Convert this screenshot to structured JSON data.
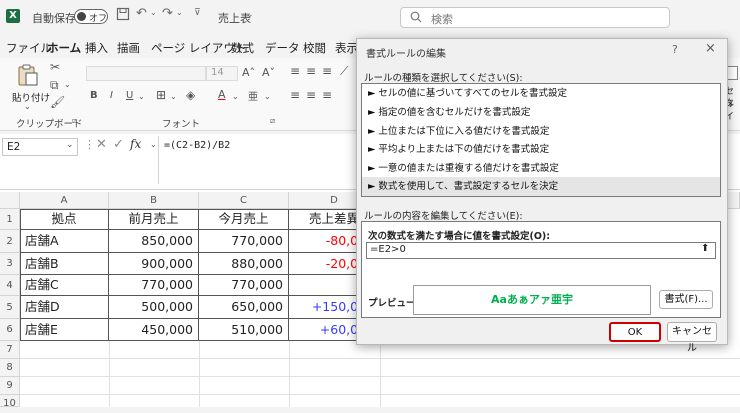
{
  "titlebar": {
    "app_icon": "X",
    "autosave_label": "自動保存",
    "autosave_state": "オフ",
    "filename": "売上表",
    "search_placeholder": "検索"
  },
  "ribbon": {
    "tabs": [
      "ファイル",
      "ホーム",
      "挿入",
      "描画",
      "ページ レイアウト",
      "数式",
      "データ",
      "校閲",
      "表示"
    ],
    "paste_label": "貼り付け",
    "font_size": "14",
    "groups": {
      "clipboard": "クリップボード",
      "font": "フォント"
    },
    "cell_style_label": "セル",
    "cell_style_label2": "タイ"
  },
  "formula_bar": {
    "cell_ref": "E2",
    "formula": "=(C2-B2)/B2",
    "fx": "fx"
  },
  "sheet": {
    "columns": [
      "A",
      "B",
      "C",
      "D"
    ],
    "row_numbers": [
      "1",
      "2",
      "3",
      "4",
      "5",
      "6",
      "7",
      "8",
      "9",
      "10"
    ],
    "header": [
      "拠点",
      "前月売上",
      "今月売上",
      "売上差異"
    ],
    "rows": [
      {
        "store": "店舗A",
        "prev": "850,000",
        "curr": "770,000",
        "diff": "-80,000"
      },
      {
        "store": "店舗B",
        "prev": "900,000",
        "curr": "880,000",
        "diff": "-20,000"
      },
      {
        "store": "店舗C",
        "prev": "770,000",
        "curr": "770,000",
        "diff": ""
      },
      {
        "store": "店舗D",
        "prev": "500,000",
        "curr": "650,000",
        "diff": "+150,000"
      },
      {
        "store": "店舗E",
        "prev": "450,000",
        "curr": "510,000",
        "diff": "+60,000"
      }
    ]
  },
  "dialog": {
    "title": "書式ルールの編集",
    "help": "?",
    "close": "×",
    "rule_type_label": "ルールの種類を選択してください(S):",
    "rule_types": [
      "セルの値に基づいてすべてのセルを書式設定",
      "指定の値を含むセルだけを書式設定",
      "上位または下位に入る値だけを書式設定",
      "平均より上または下の値だけを書式設定",
      "一意の値または重複する値だけを書式設定",
      "数式を使用して、書式設定するセルを決定"
    ],
    "selected_rule_index": 5,
    "edit_label": "ルールの内容を編集してください(E):",
    "formula_label": "次の数式を満たす場合に値を書式設定(O):",
    "formula_value": "=E2>0",
    "preview_label": "プレビュー:",
    "preview_text": "Aaあぁアァ亜宇",
    "preview_color": "#00b050",
    "format_button": "書式(F)...",
    "ok_button": "OK",
    "cancel_button": "キャンセル",
    "highlight_color": "#cc0000"
  }
}
